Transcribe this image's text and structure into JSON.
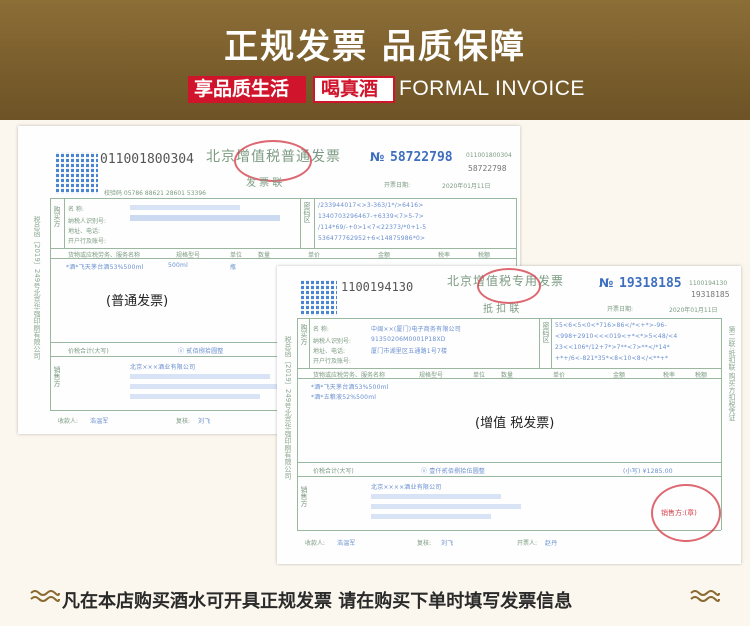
{
  "banner": {
    "title": "正规发票 品质保障",
    "tag_1": "享品质生活",
    "tag_2": "喝真酒",
    "subtitle": "FORMAL INVOICE"
  },
  "invoice_1": {
    "code": "011001800304",
    "header": "北京增值税普通发票",
    "no_prefix": "№",
    "number": "58722798",
    "number_small_code": "011001800304",
    "number_small": "58722798",
    "date_label": "开票日期:",
    "date_value": "2020年01月11日",
    "copy_name": "发 票 联",
    "check_code": "校验码 05786 88621 28601 53396",
    "buyer_rows": [
      "名 称:",
      "纳税人识别号:",
      "地址、电话:",
      "开户行及账号:"
    ],
    "buyer_side": "购买方",
    "cipher_side": "密码区",
    "cipher_lines": [
      "/233944017<>3-363/1*/>6416>",
      "1340703296467-+6339<7>5-7>",
      "/114*69/-+0>1<7<22373/*0+1-5",
      "536477762952+6<14875986*0>"
    ],
    "items_header": [
      "货物或应税劳务、服务名称",
      "规格型号",
      "单位",
      "数量",
      "单价",
      "金额",
      "税率",
      "税额"
    ],
    "item_lines": [
      "*酒*飞天茅台酒53%500ml",
      "500ml",
      "瓶"
    ],
    "total_label": "价税合计(大写)",
    "total_words": "ⓧ 贰佰捌拾圆整",
    "seller_side": "销售方",
    "seller_name": "北京×××酒业有限公司",
    "payee_label": "收款人:",
    "payee": "浩温军",
    "reviewer_label": "复核:",
    "reviewer": "刘飞",
    "caption": "(普通发票)",
    "vertical_note": "税总函〔2019〕249号北京华强印刷有限公司"
  },
  "invoice_2": {
    "code": "1100194130",
    "header": "北京增值税专用发票",
    "no_prefix": "№",
    "number": "19318185",
    "number_small_code": "1100194130",
    "number_small": "19318185",
    "date_label": "开票日期:",
    "date_value": "2020年01月11日",
    "copy_name": "抵 扣 联",
    "buyer_rows": [
      "名 称:",
      "纳税人识别号:",
      "地址、电话:",
      "开户行及账号:"
    ],
    "buyer_values": [
      "中闽××(厦门)电子商务有限公司",
      "91350206M0001P18XD",
      "厦门市湖里区五通路1号7楼"
    ],
    "buyer_side": "购买方",
    "cipher_side": "密码区",
    "cipher_lines": [
      "55<6<5<0<*716>86</*<+*>-96-",
      "<998+2910<<<019<+*<*>5<48/<4",
      "23<<106*/12+7*>7**<7>**</*14*",
      "+*+/6<-821*35*<8<10<8</<**+*"
    ],
    "items_header": [
      "货物或应税劳务、服务名称",
      "规格型号",
      "单位",
      "数量",
      "单价",
      "金额",
      "税率",
      "税额"
    ],
    "item_lines": [
      "*酒*飞天茅台酒53%500ml",
      "*酒*五粮液52%500ml"
    ],
    "total_label": "价税合计(大写)",
    "total_words": "ⓧ 壹仟贰佰捌拾伍圆整",
    "total_small": "(小写) ¥1285.00",
    "seller_side": "销售方",
    "seller_name": "北京××××酒业有限公司",
    "payee_label": "收款人:",
    "payee": "浩温军",
    "reviewer_label": "复核:",
    "reviewer": "刘飞",
    "issuer_label": "开票人:",
    "issuer": "赵丹",
    "seller_stamp_label": "销售方:(章)",
    "caption": "(增值 税发票)",
    "vertical_note": "税总函〔2019〕249号北京华强印刷有限公司",
    "side_note": "第二联:抵扣联 购买方扣税凭证"
  },
  "footer": {
    "text": "凡在本店购买酒水可开具正规发票  请在购买下单时填写发票信息"
  }
}
